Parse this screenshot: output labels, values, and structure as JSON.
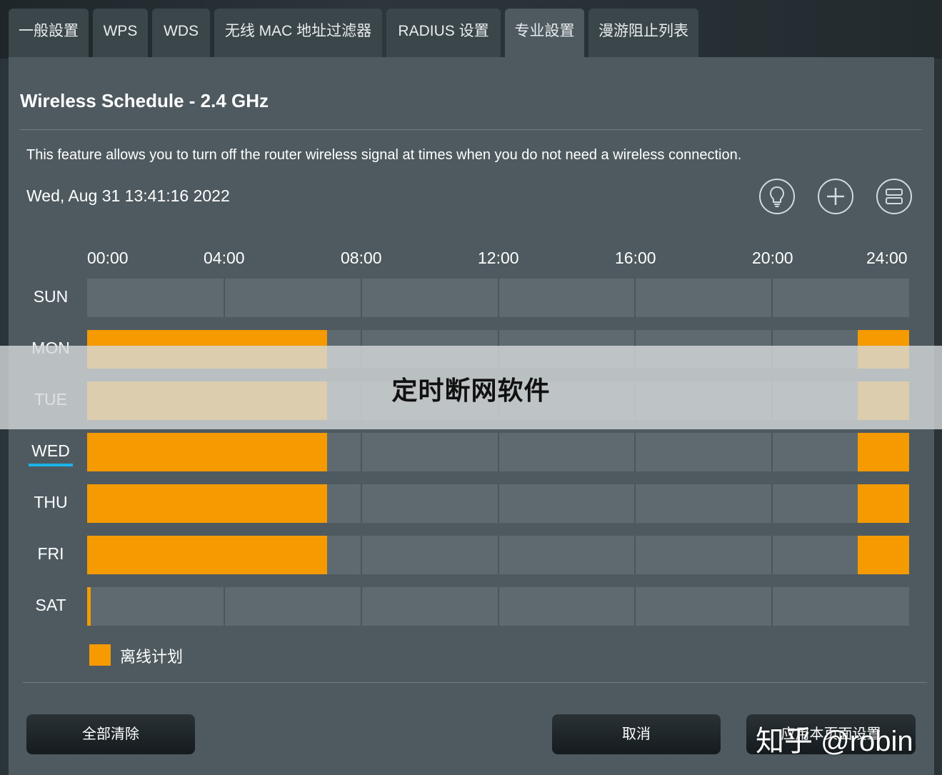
{
  "tabs": [
    {
      "label": "一般設置"
    },
    {
      "label": "WPS"
    },
    {
      "label": "WDS"
    },
    {
      "label": "无线 MAC 地址过滤器"
    },
    {
      "label": "RADIUS 设置"
    },
    {
      "label": "专业設置",
      "active": true
    },
    {
      "label": "漫游阻止列表"
    }
  ],
  "schedule": {
    "title": "Wireless Schedule - 2.4 GHz",
    "description": "This feature allows you to turn off the router wireless signal at times when you do not need a wireless connection.",
    "datetime": "Wed, Aug 31 13:41:16 2022",
    "icons": [
      "lightbulb-icon",
      "plus-icon",
      "list-icon"
    ],
    "hours": [
      "00:00",
      "04:00",
      "08:00",
      "12:00",
      "16:00",
      "20:00",
      "24:00"
    ],
    "selected_day": "WED",
    "days": [
      {
        "name": "SUN",
        "offline": []
      },
      {
        "name": "MON",
        "offline": [
          [
            0,
            7
          ],
          [
            22.5,
            24
          ]
        ]
      },
      {
        "name": "TUE",
        "offline": [
          [
            0,
            7
          ],
          [
            22.5,
            24
          ]
        ]
      },
      {
        "name": "WED",
        "offline": [
          [
            0,
            7
          ],
          [
            22.5,
            24
          ]
        ]
      },
      {
        "name": "THU",
        "offline": [
          [
            0,
            7
          ],
          [
            22.5,
            24
          ]
        ]
      },
      {
        "name": "FRI",
        "offline": [
          [
            0,
            7
          ],
          [
            22.5,
            24
          ]
        ]
      },
      {
        "name": "SAT",
        "offline": [
          [
            0,
            0.1
          ]
        ]
      }
    ],
    "legend_label": "离线计划",
    "offline_color": "#f59a00",
    "selected_underline_color": "#1ab4e8"
  },
  "buttons": {
    "clear_all": "全部清除",
    "cancel": "取消",
    "apply": "应用本页面设置"
  },
  "overlay": {
    "title": "定时断网软件"
  },
  "watermark": "知乎 @robin"
}
